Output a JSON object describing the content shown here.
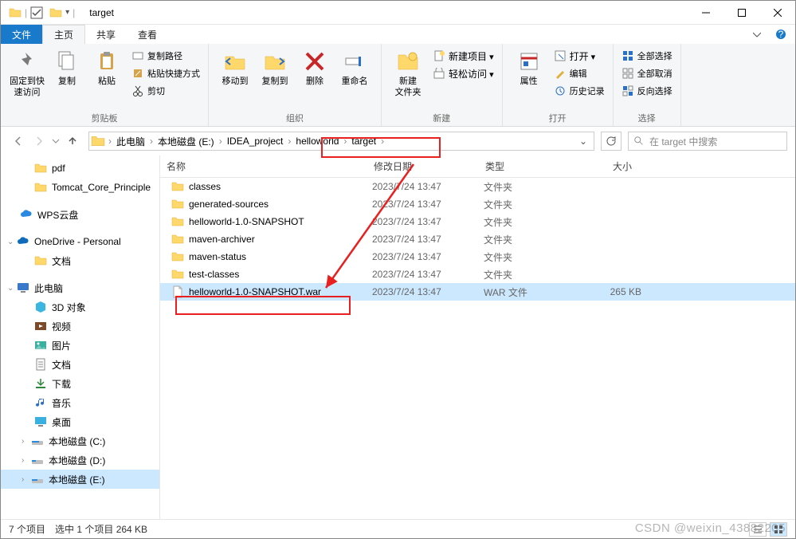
{
  "window": {
    "title": "target"
  },
  "tabs": {
    "file": "文件",
    "home": "主页",
    "share": "共享",
    "view": "查看"
  },
  "ribbon": {
    "clipboard": {
      "label": "剪贴板",
      "pin": "固定到快\n速访问",
      "copy": "复制",
      "paste": "粘贴",
      "copypath": "复制路径",
      "pasteshortcut": "粘贴快捷方式",
      "cut": "剪切"
    },
    "organize": {
      "label": "组织",
      "moveto": "移动到",
      "copyto": "复制到",
      "delete": "删除",
      "rename": "重命名"
    },
    "new_": {
      "label": "新建",
      "newfolder": "新建\n文件夹",
      "newitem": "新建项目",
      "easyaccess": "轻松访问"
    },
    "open": {
      "label": "打开",
      "properties": "属性",
      "open": "打开",
      "edit": "编辑",
      "history": "历史记录"
    },
    "select": {
      "label": "选择",
      "selectall": "全部选择",
      "selectnone": "全部取消",
      "invert": "反向选择"
    }
  },
  "breadcrumb": [
    {
      "label": "此电脑"
    },
    {
      "label": "本地磁盘 (E:)"
    },
    {
      "label": "IDEA_project"
    },
    {
      "label": "helloworld"
    },
    {
      "label": "target"
    }
  ],
  "search": {
    "placeholder": "在 target 中搜索"
  },
  "tree": {
    "quick": [
      {
        "label": "pdf",
        "icon": "folder"
      },
      {
        "label": "Tomcat_Core_Principle",
        "icon": "folder"
      }
    ],
    "wps": {
      "label": "WPS云盘"
    },
    "onedrive": {
      "label": "OneDrive - Personal",
      "children": [
        {
          "label": "文档",
          "icon": "folder"
        }
      ]
    },
    "pc": {
      "label": "此电脑",
      "children": [
        {
          "label": "3D 对象"
        },
        {
          "label": "视频"
        },
        {
          "label": "图片"
        },
        {
          "label": "文档"
        },
        {
          "label": "下载"
        },
        {
          "label": "音乐"
        },
        {
          "label": "桌面"
        },
        {
          "label": "本地磁盘 (C:)"
        },
        {
          "label": "本地磁盘 (D:)"
        },
        {
          "label": "本地磁盘 (E:)",
          "selected": true
        }
      ]
    }
  },
  "columns": {
    "name": "名称",
    "date": "修改日期",
    "type": "类型",
    "size": "大小"
  },
  "rows": [
    {
      "name": "classes",
      "date": "2023/7/24 13:47",
      "type": "文件夹",
      "size": "",
      "icon": "folder"
    },
    {
      "name": "generated-sources",
      "date": "2023/7/24 13:47",
      "type": "文件夹",
      "size": "",
      "icon": "folder"
    },
    {
      "name": "helloworld-1.0-SNAPSHOT",
      "date": "2023/7/24 13:47",
      "type": "文件夹",
      "size": "",
      "icon": "folder"
    },
    {
      "name": "maven-archiver",
      "date": "2023/7/24 13:47",
      "type": "文件夹",
      "size": "",
      "icon": "folder"
    },
    {
      "name": "maven-status",
      "date": "2023/7/24 13:47",
      "type": "文件夹",
      "size": "",
      "icon": "folder"
    },
    {
      "name": "test-classes",
      "date": "2023/7/24 13:47",
      "type": "文件夹",
      "size": "",
      "icon": "folder"
    },
    {
      "name": "helloworld-1.0-SNAPSHOT.war",
      "date": "2023/7/24 13:47",
      "type": "WAR 文件",
      "size": "265 KB",
      "icon": "file",
      "selected": true
    }
  ],
  "status": {
    "count": "7 个项目",
    "sel": "选中 1 个项目  264 KB"
  },
  "watermark": "CSDN @weixin_43882205"
}
